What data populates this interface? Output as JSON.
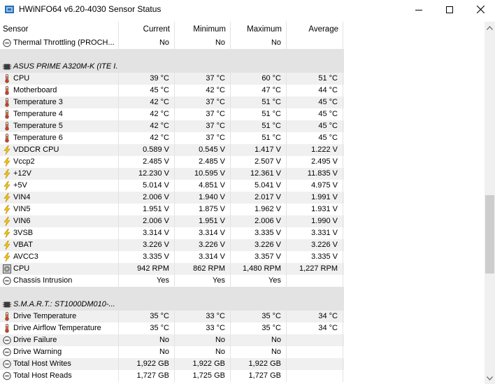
{
  "window": {
    "title": "HWiNFO64 v6.20-4030 Sensor Status"
  },
  "columns": {
    "sensor": "Sensor",
    "current": "Current",
    "minimum": "Minimum",
    "maximum": "Maximum",
    "average": "Average"
  },
  "rows": [
    {
      "type": "data",
      "icon": "clock-icon",
      "name": "Thermal Throttling (PROCH...",
      "v": [
        "No",
        "No",
        "No",
        ""
      ]
    },
    {
      "type": "blank"
    },
    {
      "type": "group",
      "icon": "chip-icon",
      "name": "ASUS PRIME A320M-K (ITE I..."
    },
    {
      "type": "data",
      "icon": "thermometer-icon",
      "name": "CPU",
      "v": [
        "39 °C",
        "37 °C",
        "60 °C",
        "51 °C"
      ]
    },
    {
      "type": "data",
      "icon": "thermometer-icon",
      "name": "Motherboard",
      "v": [
        "45 °C",
        "42 °C",
        "47 °C",
        "44 °C"
      ]
    },
    {
      "type": "data",
      "icon": "thermometer-icon",
      "name": "Temperature 3",
      "v": [
        "42 °C",
        "37 °C",
        "51 °C",
        "45 °C"
      ]
    },
    {
      "type": "data",
      "icon": "thermometer-icon",
      "name": "Temperature 4",
      "v": [
        "42 °C",
        "37 °C",
        "51 °C",
        "45 °C"
      ]
    },
    {
      "type": "data",
      "icon": "thermometer-icon",
      "name": "Temperature 5",
      "v": [
        "42 °C",
        "37 °C",
        "51 °C",
        "45 °C"
      ]
    },
    {
      "type": "data",
      "icon": "thermometer-icon",
      "name": "Temperature 6",
      "v": [
        "42 °C",
        "37 °C",
        "51 °C",
        "45 °C"
      ]
    },
    {
      "type": "data",
      "icon": "voltage-icon",
      "name": "VDDCR CPU",
      "v": [
        "0.589 V",
        "0.545 V",
        "1.417 V",
        "1.222 V"
      ]
    },
    {
      "type": "data",
      "icon": "voltage-icon",
      "name": "Vccp2",
      "v": [
        "2.485 V",
        "2.485 V",
        "2.507 V",
        "2.495 V"
      ]
    },
    {
      "type": "data",
      "icon": "voltage-icon",
      "name": "+12V",
      "v": [
        "12.230 V",
        "10.595 V",
        "12.361 V",
        "11.835 V"
      ]
    },
    {
      "type": "data",
      "icon": "voltage-icon",
      "name": "+5V",
      "v": [
        "5.014 V",
        "4.851 V",
        "5.041 V",
        "4.975 V"
      ]
    },
    {
      "type": "data",
      "icon": "voltage-icon",
      "name": "VIN4",
      "v": [
        "2.006 V",
        "1.940 V",
        "2.017 V",
        "1.991 V"
      ]
    },
    {
      "type": "data",
      "icon": "voltage-icon",
      "name": "VIN5",
      "v": [
        "1.951 V",
        "1.875 V",
        "1.962 V",
        "1.931 V"
      ]
    },
    {
      "type": "data",
      "icon": "voltage-icon",
      "name": "VIN6",
      "v": [
        "2.006 V",
        "1.951 V",
        "2.006 V",
        "1.990 V"
      ]
    },
    {
      "type": "data",
      "icon": "voltage-icon",
      "name": "3VSB",
      "v": [
        "3.314 V",
        "3.314 V",
        "3.335 V",
        "3.331 V"
      ]
    },
    {
      "type": "data",
      "icon": "voltage-icon",
      "name": "VBAT",
      "v": [
        "3.226 V",
        "3.226 V",
        "3.226 V",
        "3.226 V"
      ]
    },
    {
      "type": "data",
      "icon": "voltage-icon",
      "name": "AVCC3",
      "v": [
        "3.335 V",
        "3.314 V",
        "3.357 V",
        "3.335 V"
      ]
    },
    {
      "type": "data",
      "icon": "fan-icon",
      "name": "CPU",
      "v": [
        "942 RPM",
        "862 RPM",
        "1,480 RPM",
        "1,227 RPM"
      ]
    },
    {
      "type": "data",
      "icon": "clock-icon",
      "name": "Chassis Intrusion",
      "v": [
        "Yes",
        "Yes",
        "Yes",
        ""
      ]
    },
    {
      "type": "blank"
    },
    {
      "type": "group",
      "icon": "chip-icon",
      "name": "S.M.A.R.T.: ST1000DM010-..."
    },
    {
      "type": "data",
      "icon": "thermometer-icon",
      "name": "Drive Temperature",
      "v": [
        "35 °C",
        "33 °C",
        "35 °C",
        "34 °C"
      ]
    },
    {
      "type": "data",
      "icon": "thermometer-icon",
      "name": "Drive Airflow Temperature",
      "v": [
        "35 °C",
        "33 °C",
        "35 °C",
        "34 °C"
      ]
    },
    {
      "type": "data",
      "icon": "clock-icon",
      "name": "Drive Failure",
      "v": [
        "No",
        "No",
        "No",
        ""
      ]
    },
    {
      "type": "data",
      "icon": "clock-icon",
      "name": "Drive Warning",
      "v": [
        "No",
        "No",
        "No",
        ""
      ]
    },
    {
      "type": "data",
      "icon": "clock-icon",
      "name": "Total Host Writes",
      "v": [
        "1,922 GB",
        "1,922 GB",
        "1,922 GB",
        ""
      ]
    },
    {
      "type": "data",
      "icon": "clock-icon",
      "name": "Total Host Reads",
      "v": [
        "1,727 GB",
        "1,725 GB",
        "1,727 GB",
        ""
      ]
    }
  ]
}
